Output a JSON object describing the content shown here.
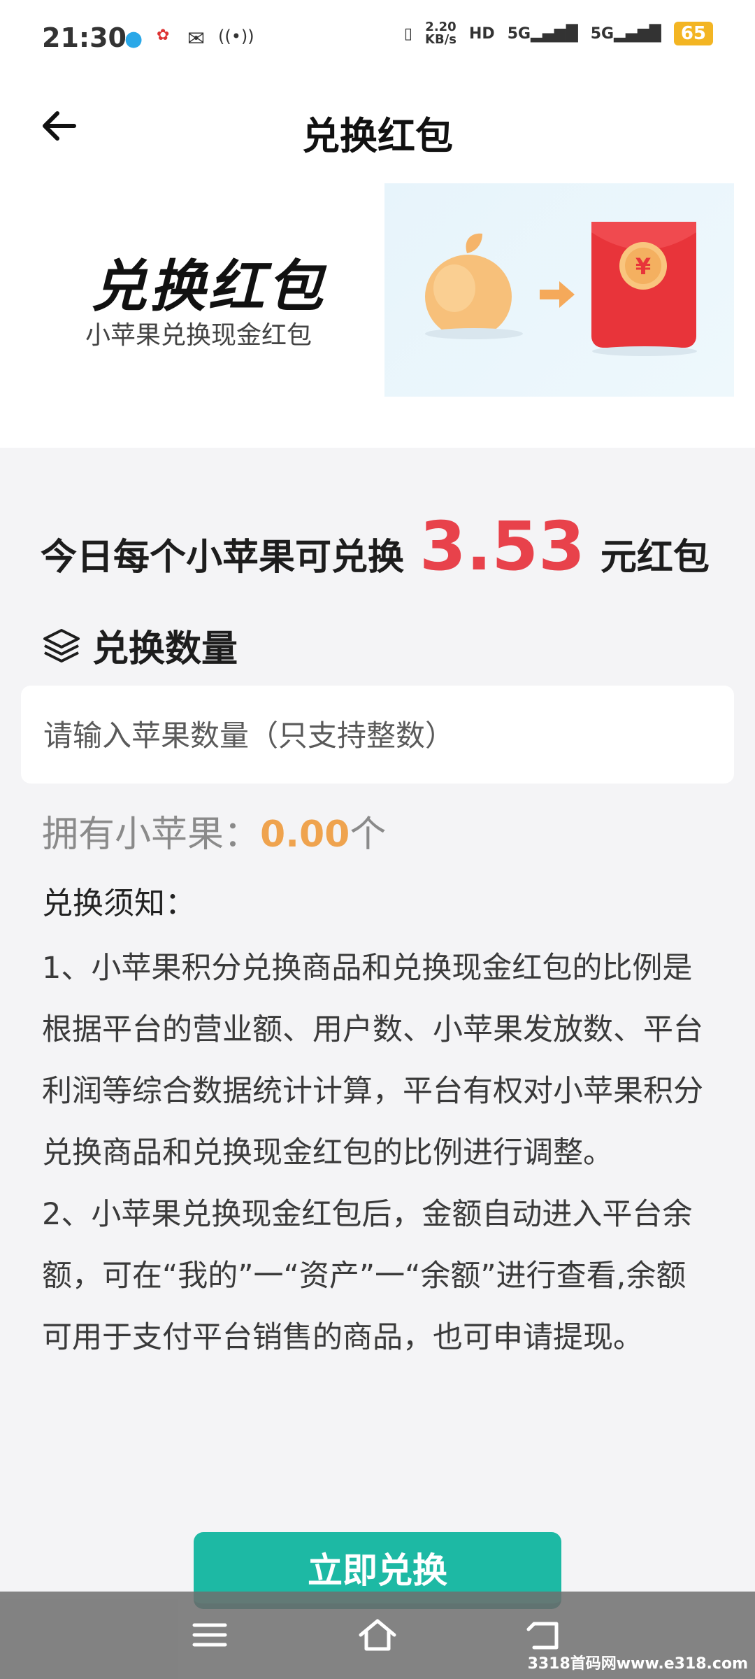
{
  "status_bar": {
    "time": "21:30",
    "speed_value": "2.20",
    "speed_unit": "KB/s",
    "hd_label": "HD",
    "sim1_label": "5G",
    "sim2_label": "5G",
    "battery": "65"
  },
  "nav": {
    "title": "兑换红包"
  },
  "banner": {
    "title": "兑换红包",
    "subtitle": "小苹果兑换现金红包",
    "currency_symbol": "¥"
  },
  "rate": {
    "prefix": "今日每个小苹果可兑换",
    "value": "3.53",
    "suffix": "元红包"
  },
  "quantity": {
    "heading": "兑换数量",
    "placeholder": "请输入苹果数量（只支持整数）"
  },
  "owned": {
    "label": "拥有小苹果：",
    "value": "0.00",
    "unit": "个"
  },
  "notice": {
    "title": "兑换须知：",
    "items": [
      "1、小苹果积分兑换商品和兑换现金红包的比例是根据平台的营业额、用户数、小苹果发放数、平台利润等综合数据统计计算，平台有权对小苹果积分兑换商品和兑换现金红包的比例进行调整。",
      "2、小苹果兑换现金红包后，金额自动进入平台余额，可在“我的”一“资产”一“余额”进行查看,余额可用于支付平台销售的商品，也可申请提现。"
    ]
  },
  "action": {
    "button_label": "立即兑换"
  },
  "watermark": "3318首码网www.e318.com",
  "colors": {
    "accent": "#1db9a4",
    "rate_value": "#e8424b",
    "owned_value": "#efa34e"
  }
}
